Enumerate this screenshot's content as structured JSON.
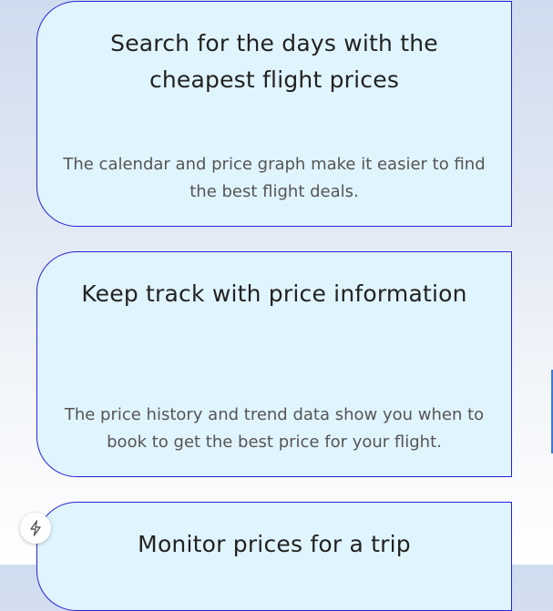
{
  "cards": [
    {
      "title": "Search for the days with the cheapest flight prices",
      "description": "The calendar and price graph make it easier to find the best flight deals."
    },
    {
      "title": "Keep track with price information",
      "description": "The price history and trend data show you when to book to get the best price for your flight."
    },
    {
      "title": "Monitor prices for a trip",
      "description": ""
    }
  ],
  "colors": {
    "card_background": "#e0f4fe",
    "card_border": "#2a22d6",
    "title_text": "#222222",
    "description_text": "#555555",
    "scroll_thumb": "#3a7bd5"
  },
  "floating_button": {
    "icon": "lightning-bolt-icon"
  }
}
